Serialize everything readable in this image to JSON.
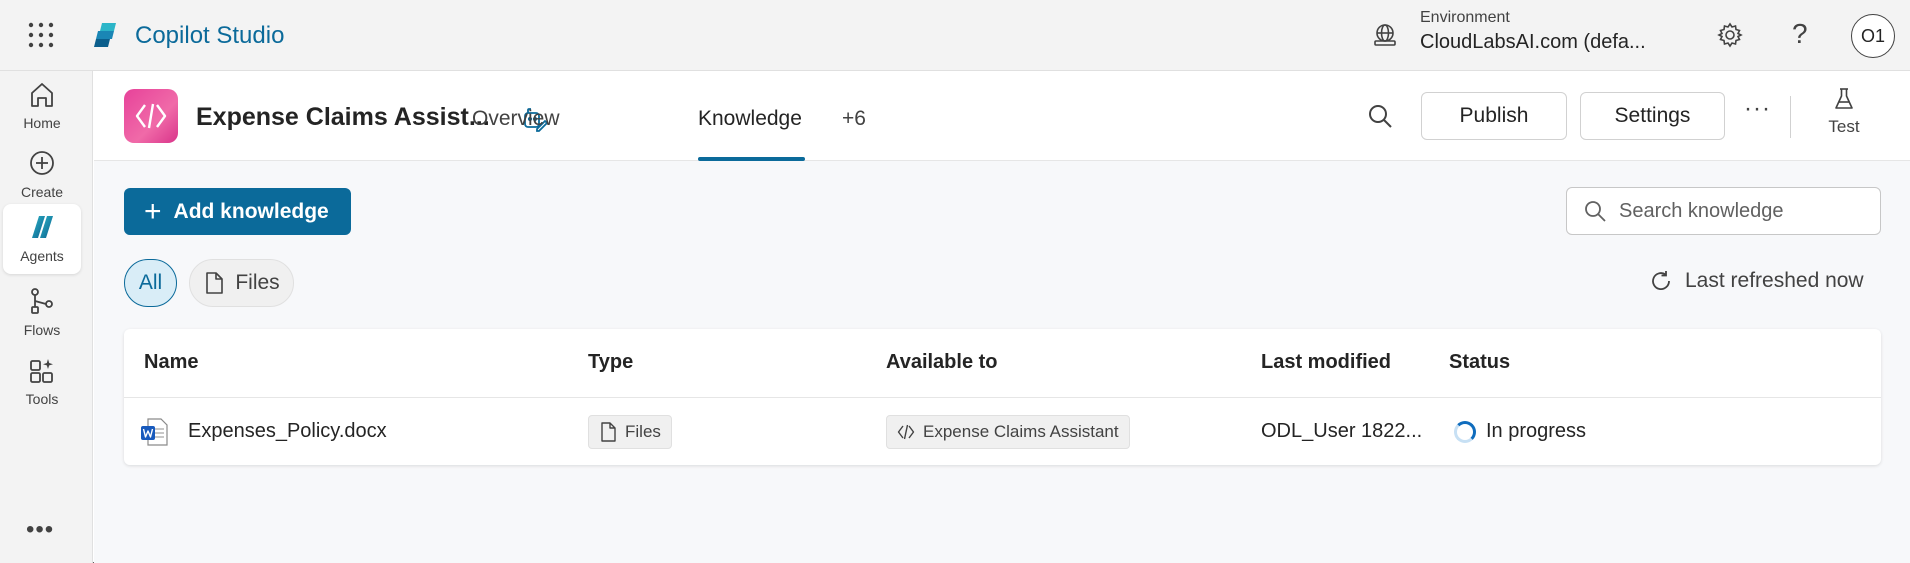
{
  "topbar": {
    "app_name": "Copilot Studio",
    "environment_label": "Environment",
    "environment_value": "CloudLabsAI.com (defa...",
    "help_glyph": "?",
    "avatar_initials": "O1"
  },
  "rail": {
    "items": [
      {
        "label": "Home",
        "icon": "home-icon"
      },
      {
        "label": "Create",
        "icon": "plus-circle-icon"
      },
      {
        "label": "Agents",
        "icon": "agents-icon",
        "active": true
      },
      {
        "label": "Flows",
        "icon": "flows-icon"
      },
      {
        "label": "Tools",
        "icon": "tools-icon"
      }
    ],
    "more_glyph": "•••"
  },
  "agent": {
    "name": "Expense Claims Assist...",
    "tabs": [
      {
        "label": "Overview"
      },
      {
        "label": "Knowledge",
        "active": true
      },
      {
        "label": "+6"
      }
    ],
    "publish_label": "Publish",
    "settings_label": "Settings",
    "more_glyph": "···",
    "test_label": "Test"
  },
  "knowledge": {
    "add_label": "Add knowledge",
    "search_placeholder": "Search knowledge",
    "filters": [
      {
        "label": "All",
        "active": true
      },
      {
        "label": "Files"
      }
    ],
    "refresh_label": "Last refreshed now",
    "columns": [
      "Name",
      "Type",
      "Available to",
      "Last modified",
      "Status"
    ],
    "rows": [
      {
        "name": "Expenses_Policy.docx",
        "type": "Files",
        "available_to": "Expense Claims Assistant",
        "last_modified": "ODL_User 1822...",
        "status": "In progress"
      }
    ]
  },
  "colors": {
    "accent": "#0b6a9a",
    "agent_logo": "#e7429a"
  }
}
